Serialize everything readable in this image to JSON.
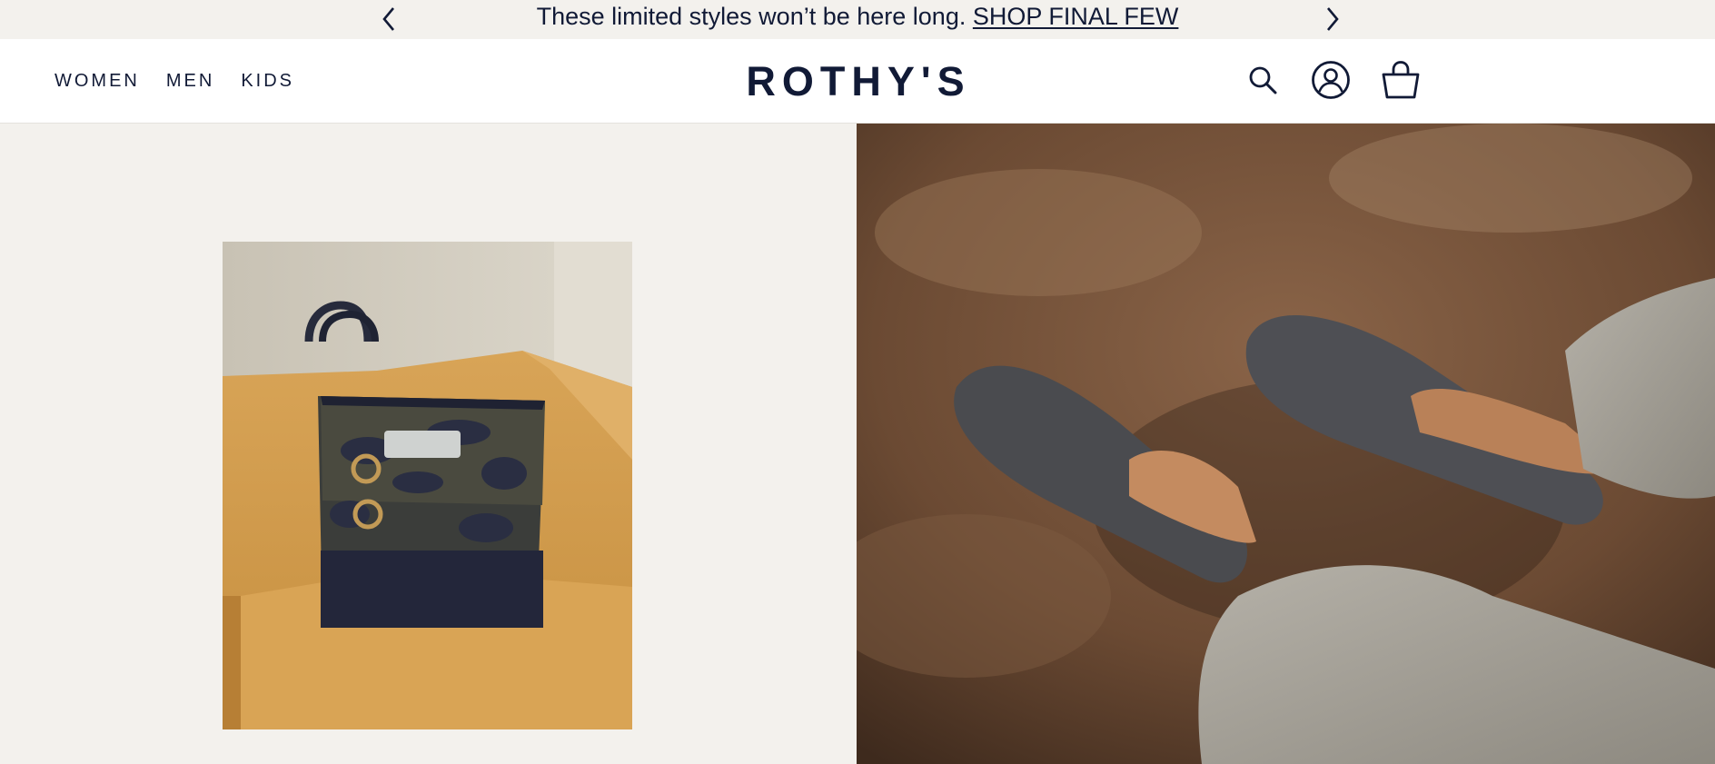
{
  "announcement": {
    "message": "These limited styles won’t be here long.",
    "link_label": "SHOP FINAL FEW",
    "prev_icon": "chevron-left-icon",
    "next_icon": "chevron-right-icon"
  },
  "header": {
    "nav": [
      {
        "label": "WOMEN"
      },
      {
        "label": "MEN"
      },
      {
        "label": "KIDS"
      }
    ],
    "logo": "ROTHY'S",
    "icons": [
      "search-icon",
      "account-icon",
      "cart-icon"
    ]
  },
  "colors": {
    "navy": "#111a36",
    "announcement_bg": "#f3f1ed",
    "header_bg": "#ffffff",
    "hero_left_bg": "#f3f1ed"
  }
}
